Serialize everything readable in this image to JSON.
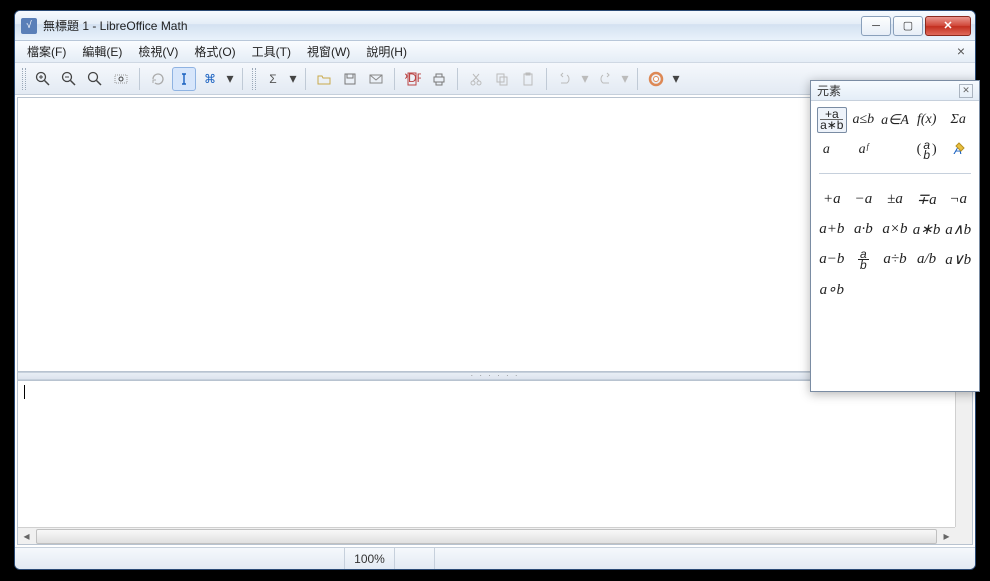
{
  "window": {
    "title": "無標題 1 - LibreOffice Math"
  },
  "menu": {
    "file": "檔案(F)",
    "edit": "編輯(E)",
    "view": "檢視(V)",
    "format": "格式(O)",
    "tools": "工具(T)",
    "window": "視窗(W)",
    "help": "說明(H)"
  },
  "status": {
    "zoom": "100%"
  },
  "panel": {
    "title": "元素",
    "categories": {
      "unary_binary_top": "+a",
      "unary_binary_bottom": "a∗b",
      "relations": "a≤b",
      "set_ops": "a∈A",
      "functions": "f(x)",
      "operators": "Σa",
      "attributes": "a⃗",
      "others": "aᶠ",
      "brackets_outer": "(",
      "brackets_inner": "a",
      "brackets_close": ")",
      "formats": "A"
    },
    "ops": {
      "r1c1": "+a",
      "r1c2": "−a",
      "r1c3": "±a",
      "r1c4": "∓a",
      "r1c5": "¬a",
      "r2c1": "a+b",
      "r2c2": "a·b",
      "r2c3": "a×b",
      "r2c4": "a∗b",
      "r2c5": "a∧b",
      "r3c1": "a−b",
      "r3c2_num": "a",
      "r3c2_den": "b",
      "r3c3": "a÷b",
      "r3c4": "a/b",
      "r3c5": "a∨b",
      "r4c1": "a∘b"
    }
  }
}
